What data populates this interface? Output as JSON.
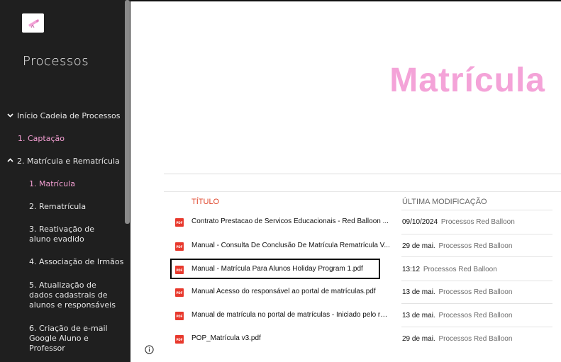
{
  "sidebar": {
    "title": "Processos",
    "items": [
      {
        "label": "Início Cadeia de Processos",
        "chevron": "chevron-down"
      },
      {
        "label": "1. Captação"
      },
      {
        "label": "2. Matrícula e Rematrícula",
        "chevron": "chevron-up"
      },
      {
        "label": "1. Matrícula"
      },
      {
        "label": "2. Rematrícula"
      },
      {
        "label": "3. Reativação de aluno evadido"
      },
      {
        "label": "4. Associação de Irmãos"
      },
      {
        "label": "5. Atualização de dados cadastrais de alunos e responsáveis"
      },
      {
        "label": "6. Criação de e-mail Google Aluno e Professor"
      }
    ]
  },
  "main": {
    "page_title": "Matrícula",
    "columns": {
      "title": "Título",
      "modified": "Última modificação"
    },
    "files": [
      {
        "name": "Contrato Prestacao de Servicos Educacionais - Red Balloon ...",
        "date": "09/10/2024",
        "owner": "Processos Red Balloon",
        "icon": "pdf-icon"
      },
      {
        "name": "Manual - Consulta De Conclusão De Matrícula Rematrícula V...",
        "date": "29 de mai.",
        "owner": "Processos Red Balloon",
        "icon": "pdf-icon"
      },
      {
        "name": "Manual - Matrícula Para Alunos Holiday Program 1.pdf",
        "date": "13:12",
        "owner": "Processos Red Balloon",
        "icon": "pdf-icon"
      },
      {
        "name": "Manual Acesso do responsável ao portal de matrículas.pdf",
        "date": "13 de mai.",
        "owner": "Processos Red Balloon",
        "icon": "pdf-icon"
      },
      {
        "name": "Manual de matrícula no portal de matrículas - Iniciado pelo re...",
        "date": "13 de mai.",
        "owner": "Processos Red Balloon",
        "icon": "pdf-icon"
      },
      {
        "name": "POP_Matrícula v3.pdf",
        "date": "29 de mai.",
        "owner": "Processos Red Balloon",
        "icon": "pdf-icon"
      }
    ],
    "pdf_badge": "PDF"
  },
  "colors": {
    "sidebar_bg": "#1f1f1f",
    "accent_pink": "#f4a3d8",
    "pdf_red": "#e8392d",
    "header_red": "#e0452b"
  }
}
